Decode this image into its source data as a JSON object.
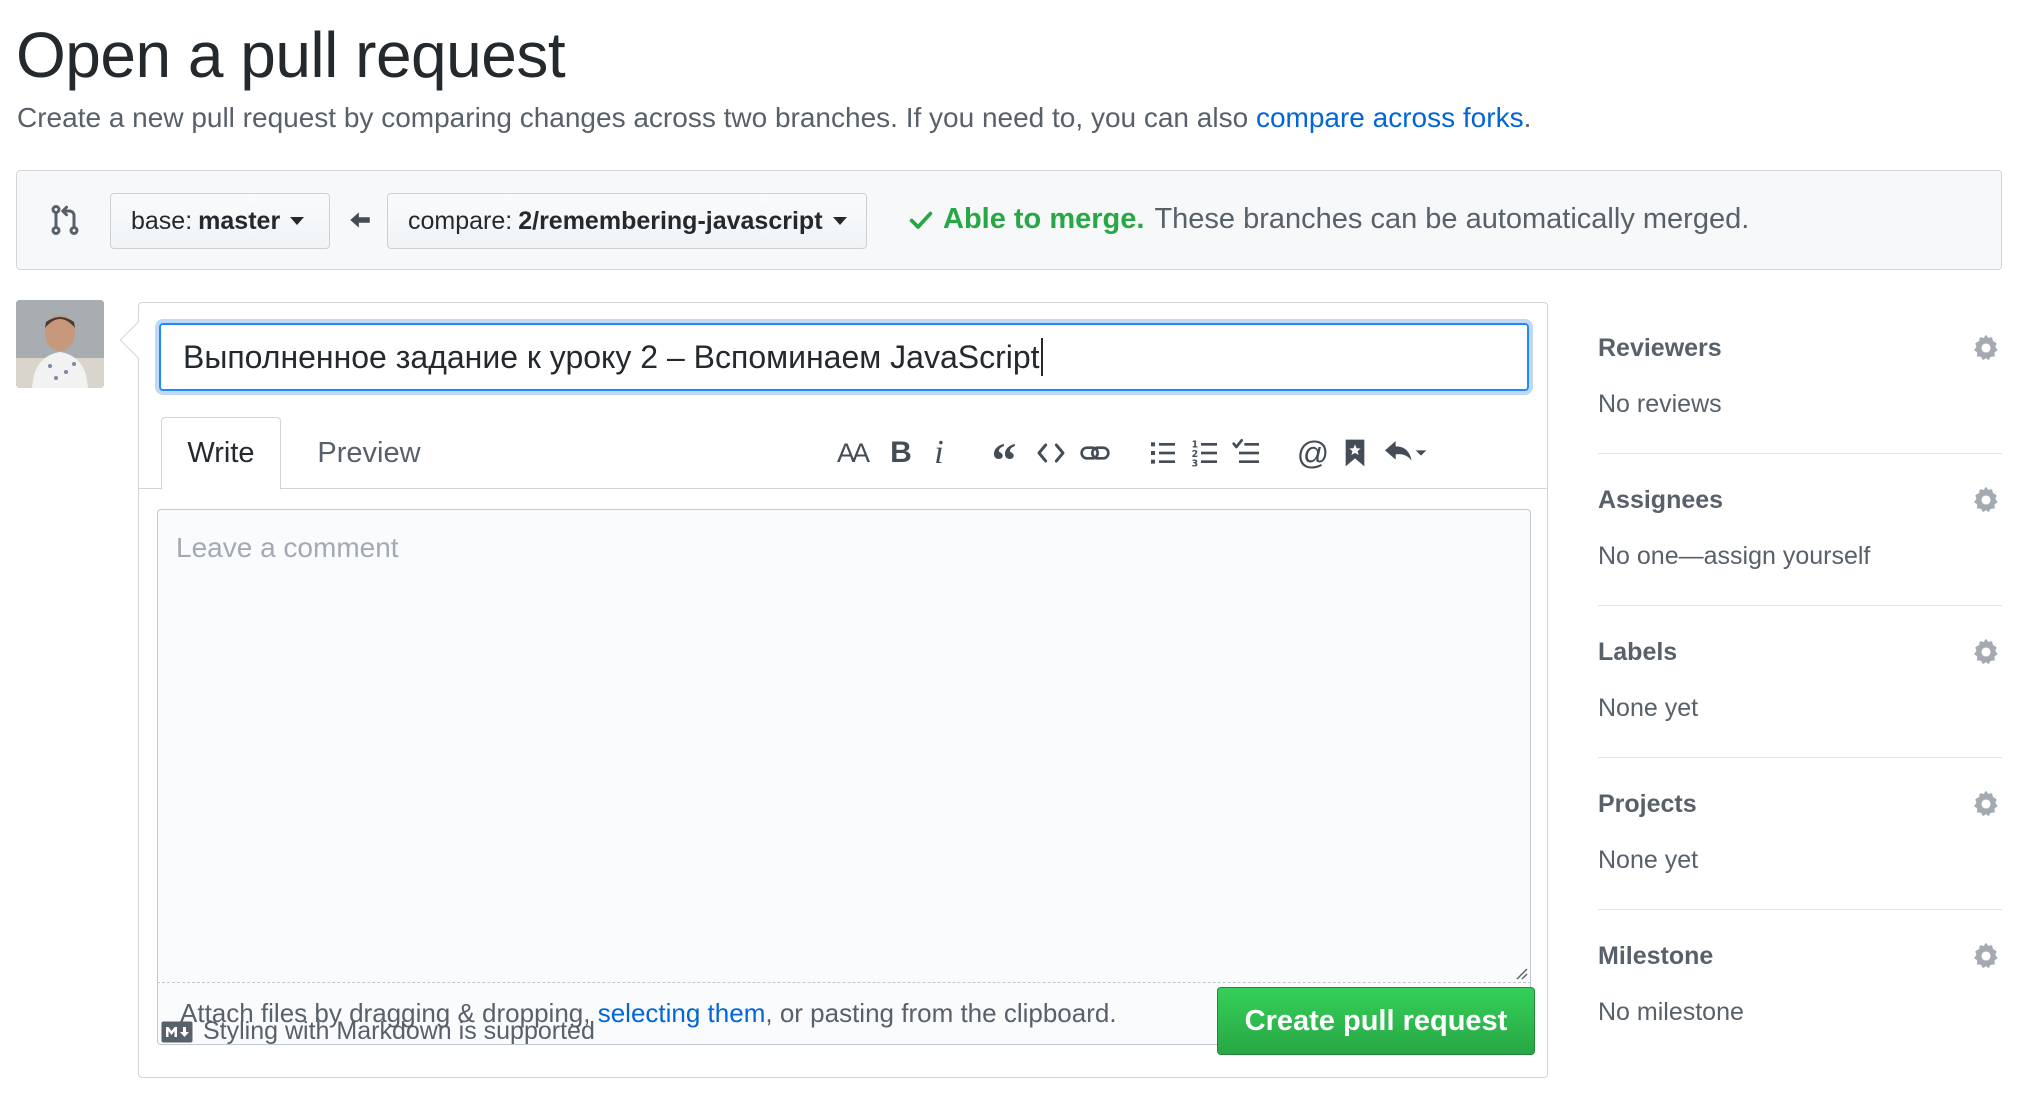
{
  "header": {
    "title": "Open a pull request",
    "subtitle_prefix": "Create a new pull request by comparing changes across two branches. If you need to, you can also",
    "subtitle_link": "compare across forks",
    "subtitle_suffix": "."
  },
  "range": {
    "base_label": "base:",
    "base_value": "master",
    "compare_label": "compare:",
    "compare_value": "2/remembering-javascript",
    "merge_ok": "Able to merge.",
    "merge_text": "These branches can be automatically merged."
  },
  "comment": {
    "title_value": "Выполненное задание к уроку 2 – Вспоминаем JavaScript",
    "tabs": [
      {
        "label": "Write",
        "active": true
      },
      {
        "label": "Preview",
        "active": false
      }
    ],
    "body_placeholder": "Leave a comment",
    "attach_prefix": "Attach files by dragging & dropping,",
    "attach_link": "selecting them",
    "attach_suffix": ", or pasting from the clipboard.",
    "markdown_note": "Styling with Markdown is supported",
    "submit_label": "Create pull request",
    "toolbar_glyphs": {
      "header": "AA",
      "bold": "B",
      "italic": "i",
      "quote": "“"
    }
  },
  "sidebar": {
    "items": [
      {
        "heading": "Reviewers",
        "value": "No reviews"
      },
      {
        "heading": "Assignees",
        "value": "No one—assign yourself"
      },
      {
        "heading": "Labels",
        "value": "None yet"
      },
      {
        "heading": "Projects",
        "value": "None yet"
      },
      {
        "heading": "Milestone",
        "value": "No milestone"
      }
    ]
  },
  "colors": {
    "link": "#0366d6",
    "success": "#28a745",
    "focus": "#2188ff",
    "muted": "#586069"
  }
}
